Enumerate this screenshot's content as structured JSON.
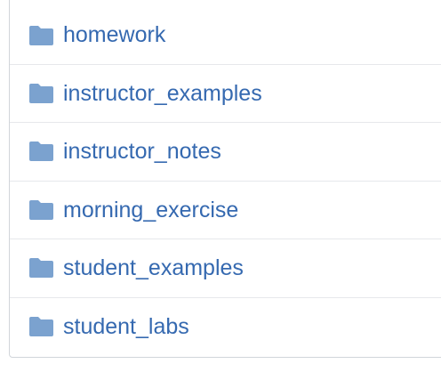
{
  "folder_color": "#7ba2cf",
  "link_color": "#3569b0",
  "items": [
    {
      "icon": "folder-icon",
      "label": "homework"
    },
    {
      "icon": "folder-icon",
      "label": "instructor_examples"
    },
    {
      "icon": "folder-icon",
      "label": "instructor_notes"
    },
    {
      "icon": "folder-icon",
      "label": "morning_exercise"
    },
    {
      "icon": "folder-icon",
      "label": "student_examples"
    },
    {
      "icon": "folder-icon",
      "label": "student_labs"
    }
  ]
}
